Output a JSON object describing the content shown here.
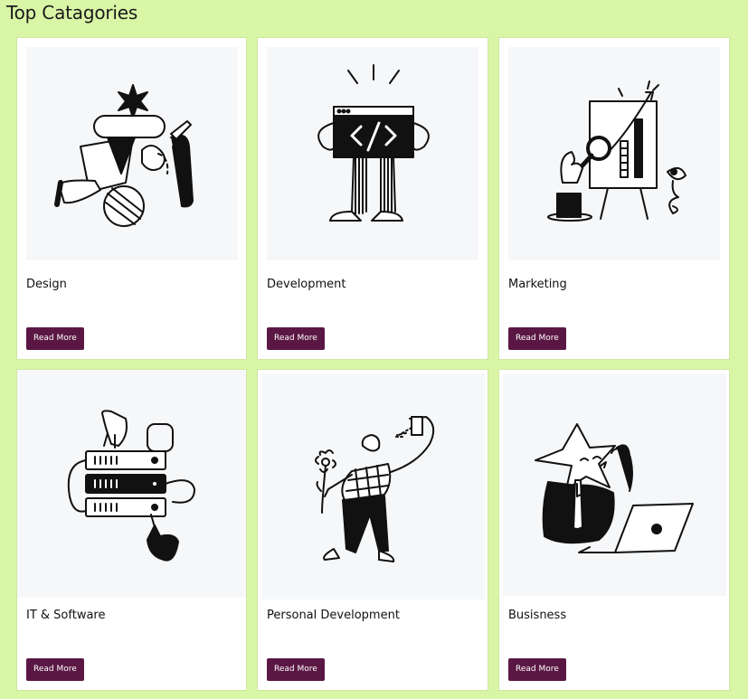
{
  "page_title": "Top Catagories",
  "cards": [
    {
      "title": "Design",
      "button": "Read More",
      "illustration": "design-illustration-icon"
    },
    {
      "title": "Development",
      "button": "Read More",
      "illustration": "code-window-illustration-icon"
    },
    {
      "title": "Marketing",
      "button": "Read More",
      "illustration": "marketing-chart-illustration-icon"
    },
    {
      "title": "IT & Software",
      "button": "Read More",
      "illustration": "server-stack-illustration-icon"
    },
    {
      "title": "Personal Development",
      "button": "Read More",
      "illustration": "person-with-flower-illustration-icon"
    },
    {
      "title": "Busisness",
      "button": "Read More",
      "illustration": "star-head-laptop-illustration-icon"
    }
  ],
  "colors": {
    "background": "#d9f5a6",
    "button": "#5b1744",
    "card": "#ffffff",
    "art_bg": "#f6f7f9"
  }
}
